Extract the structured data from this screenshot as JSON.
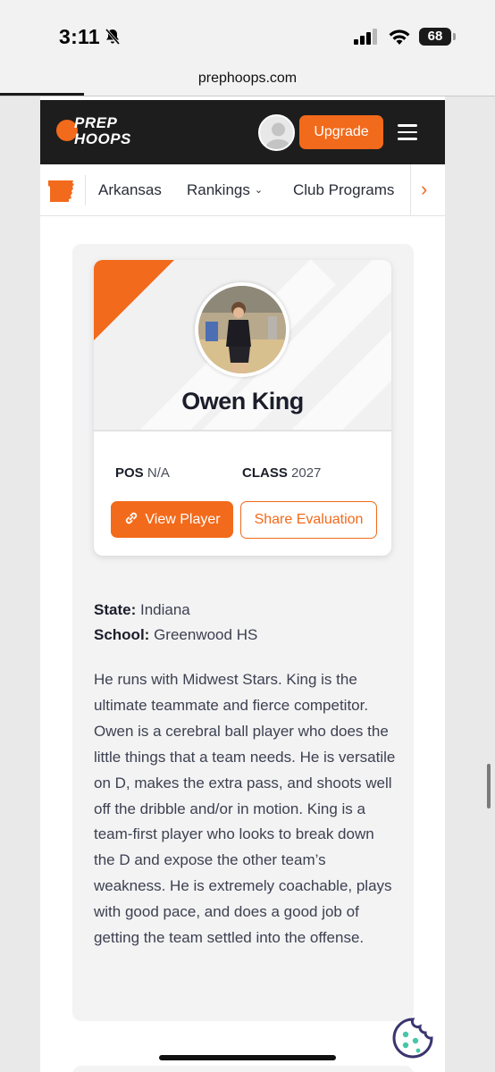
{
  "status_bar": {
    "time": "3:11",
    "battery": "68"
  },
  "browser": {
    "url": "prephoops.com",
    "load_progress": 0.17
  },
  "header": {
    "logo_line1": "PREP",
    "logo_line2": "HOOPS",
    "upgrade_label": "Upgrade"
  },
  "subnav": {
    "items": [
      {
        "label": "Arkansas"
      },
      {
        "label": "Rankings"
      },
      {
        "label": "Club Programs"
      }
    ]
  },
  "player": {
    "name": "Owen King",
    "pos_label": "POS",
    "pos_value": "N/A",
    "class_label": "CLASS",
    "class_value": "2027",
    "view_label": "View Player",
    "share_label": "Share Evaluation"
  },
  "details": {
    "state_label": "State:",
    "state_value": "Indiana",
    "school_label": "School:",
    "school_value": "Greenwood HS"
  },
  "evaluation": {
    "text": "He runs with Midwest Stars. King is the ultimate teammate and fierce competitor. Owen is a cerebral ball player who does the little things that a team needs. He is versatile on D, makes the extra pass, and shoots well off the dribble and/or in motion. King is a team-first player who looks to break down the D and expose the other team’s weakness. He is extremely coachable, plays with good pace, and does a good job of getting the team settled into the offense."
  },
  "colors": {
    "brand_orange": "#f26a1b",
    "header_dark": "#1d1d1d"
  }
}
